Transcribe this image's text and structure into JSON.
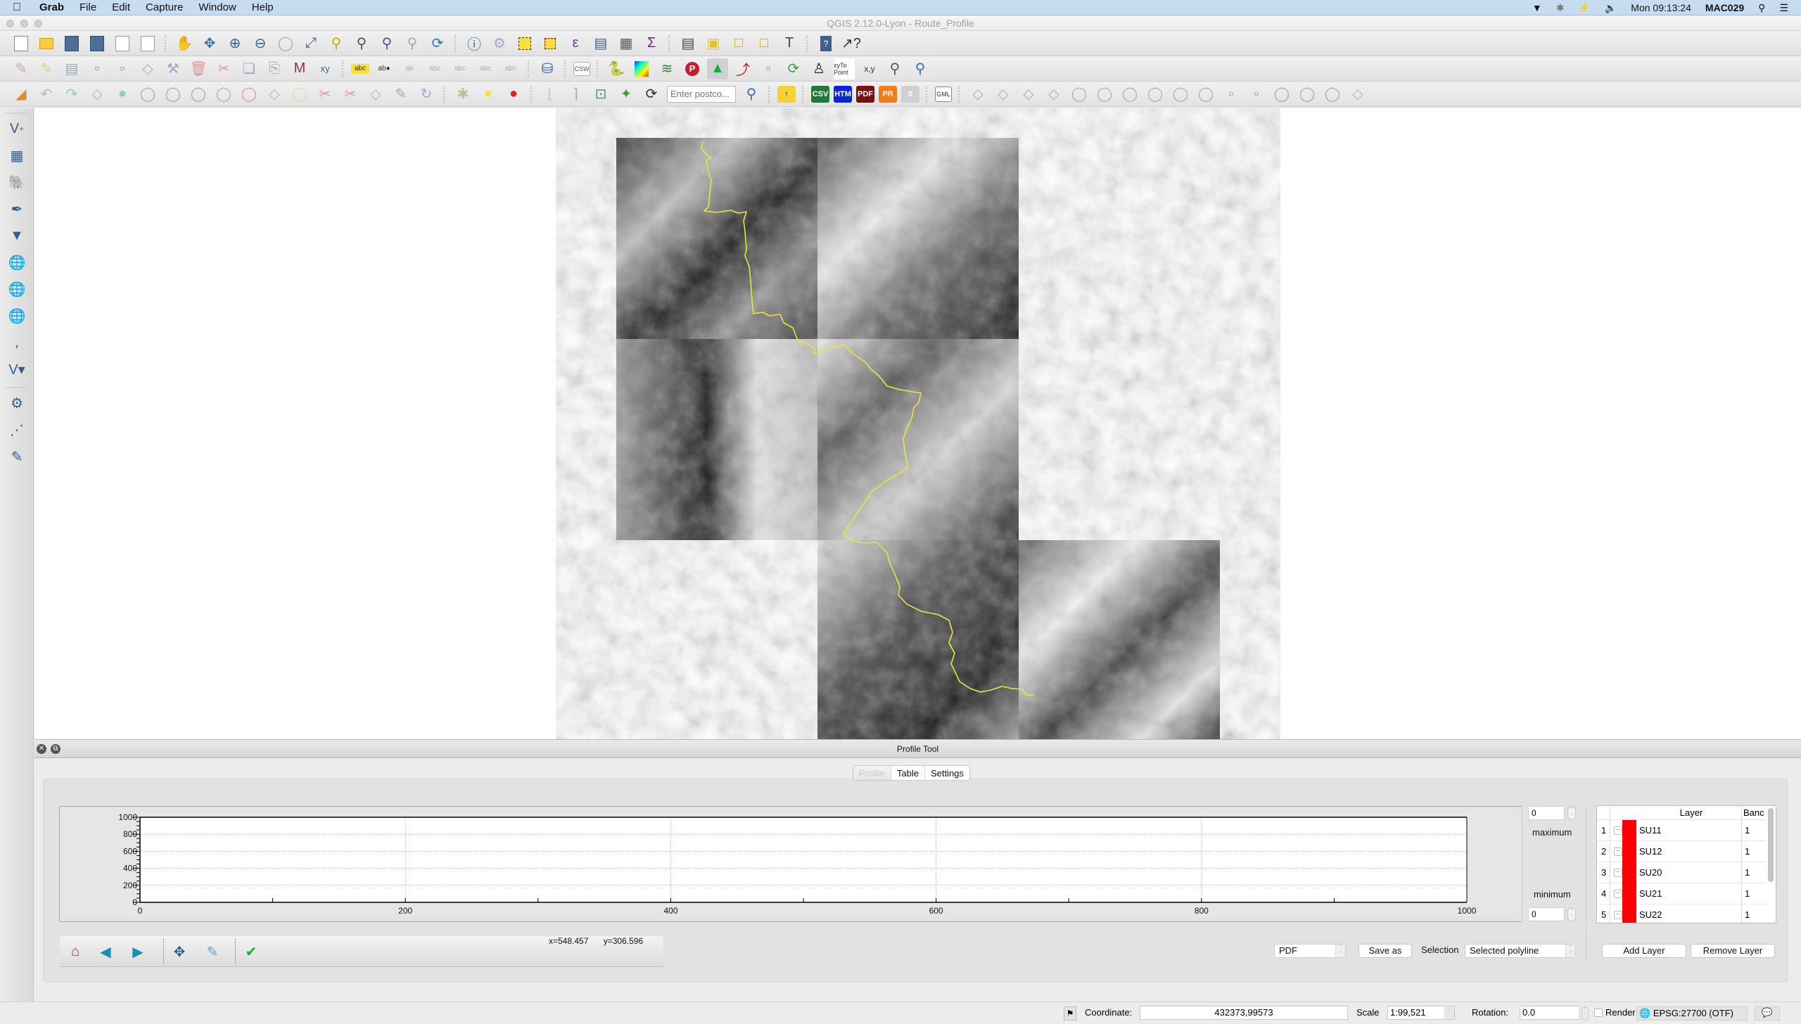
{
  "menubar": {
    "app_name": "Grab",
    "items": [
      "File",
      "Edit",
      "Capture",
      "Window",
      "Help"
    ],
    "clock": "Mon 09:13:24",
    "user": "MAC029",
    "status_icons": [
      "vpn-icon",
      "bluetooth-icon",
      "sync-icon",
      "volume-icon",
      "spotlight-search-icon",
      "notification-list-icon"
    ]
  },
  "window": {
    "title": "QGIS 2.12.0-Lyon - Route_Profile"
  },
  "toolbars": {
    "row1": [
      "new-project",
      "open-project",
      "save-project",
      "save-as",
      "new-print-composer",
      "composer-manager",
      "pan-map",
      "pan-to-selection",
      "zoom-in",
      "zoom-out",
      "zoom-native",
      "zoom-full",
      "zoom-to-selection",
      "zoom-to-layer",
      "zoom-last",
      "zoom-next",
      "refresh",
      "identify",
      "action",
      "select-features",
      "deselect-all",
      "expression-select",
      "attribute-table",
      "field-calculator",
      "statistics",
      "measure",
      "map-tips",
      "new-bookmark",
      "show-bookmarks",
      "text-annotation",
      "help-contents",
      "whats-this"
    ],
    "row2": [
      "toggle-editing",
      "current-edits",
      "save-edits",
      "add-feature",
      "node-tool",
      "move-feature",
      "node-edit",
      "delete-selected",
      "cut-features",
      "copy-features",
      "paste-features",
      "digitize",
      "xy-tool",
      "label-toolbar",
      "pin-labels",
      "show-hide-labels",
      "move-label",
      "rotate-label",
      "change-label",
      "label-properties",
      "db-manager",
      "csw",
      "python-console",
      "raster-terrain",
      "profile-line",
      "processing",
      "profile-tool",
      "simplify",
      "georeferencer",
      "refresh-layers",
      "walking-people",
      "xy-to-point",
      "xy-locate",
      "zoom-search",
      "zoom-search-2"
    ],
    "row3_input_placeholder": "Enter postco...",
    "row3_tags": [
      "CSV",
      "HTM",
      "PDF",
      "PR",
      "0",
      "GML"
    ]
  },
  "left_toolbar": [
    "add-vector-layer",
    "add-raster-layer",
    "add-postgis-layer",
    "add-spatialite-layer",
    "add-mssql-layer",
    "add-wms-layer",
    "add-wcs-layer",
    "add-wfs-layer",
    "add-delimited-text-layer",
    "new-shapefile-layer",
    "gps-tools",
    "route-editor",
    "style-editor"
  ],
  "map": {
    "route_color": "#e8e63a"
  },
  "profile_tool": {
    "title": "Profile Tool",
    "tabs": [
      {
        "label": "Profile",
        "active": true
      },
      {
        "label": "Table",
        "active": false
      },
      {
        "label": "Settings",
        "active": false
      }
    ],
    "plot_toolbar": [
      "home",
      "back",
      "forward",
      "pan",
      "edit-axes",
      "check-apply"
    ],
    "cursor_x": "x=548.457",
    "cursor_y": "y=306.596",
    "max_value": "0",
    "max_label": "maximum",
    "min_value": "0",
    "min_label": "minimum",
    "layer_table": {
      "headers": [
        "",
        "",
        "",
        "Layer",
        "Banc"
      ],
      "rows": [
        {
          "num": "1",
          "color": "#ff0000",
          "layer": "SU11",
          "band": "1"
        },
        {
          "num": "2",
          "color": "#ff0000",
          "layer": "SU12",
          "band": "1"
        },
        {
          "num": "3",
          "color": "#ff0000",
          "layer": "SU20",
          "band": "1"
        },
        {
          "num": "4",
          "color": "#ff0000",
          "layer": "SU21",
          "band": "1"
        },
        {
          "num": "5",
          "color": "#ff0000",
          "layer": "SU22",
          "band": "1"
        }
      ]
    },
    "export_format": "PDF",
    "save_as_label": "Save as",
    "selection_label": "Selection",
    "selection_value": "Selected polyline",
    "add_layer_label": "Add Layer",
    "remove_layer_label": "Remove Layer"
  },
  "chart_data": {
    "type": "line",
    "title": "",
    "xlabel": "",
    "ylabel": "",
    "series": [],
    "xlim": [
      0,
      1000
    ],
    "ylim": [
      0,
      1000
    ],
    "x_ticks": [
      0,
      200,
      400,
      600,
      800,
      1000
    ],
    "y_ticks": [
      0,
      200,
      400,
      600,
      800,
      1000
    ],
    "grid": true
  },
  "statusbar": {
    "coordinate_label": "Coordinate:",
    "coordinate_value": "432373,99573",
    "scale_label": "Scale",
    "scale_value": "1:99,521",
    "rotation_label": "Rotation:",
    "rotation_value": "0.0",
    "render_label": "Render",
    "render_checked": false,
    "crs": "EPSG:27700 (OTF)"
  }
}
